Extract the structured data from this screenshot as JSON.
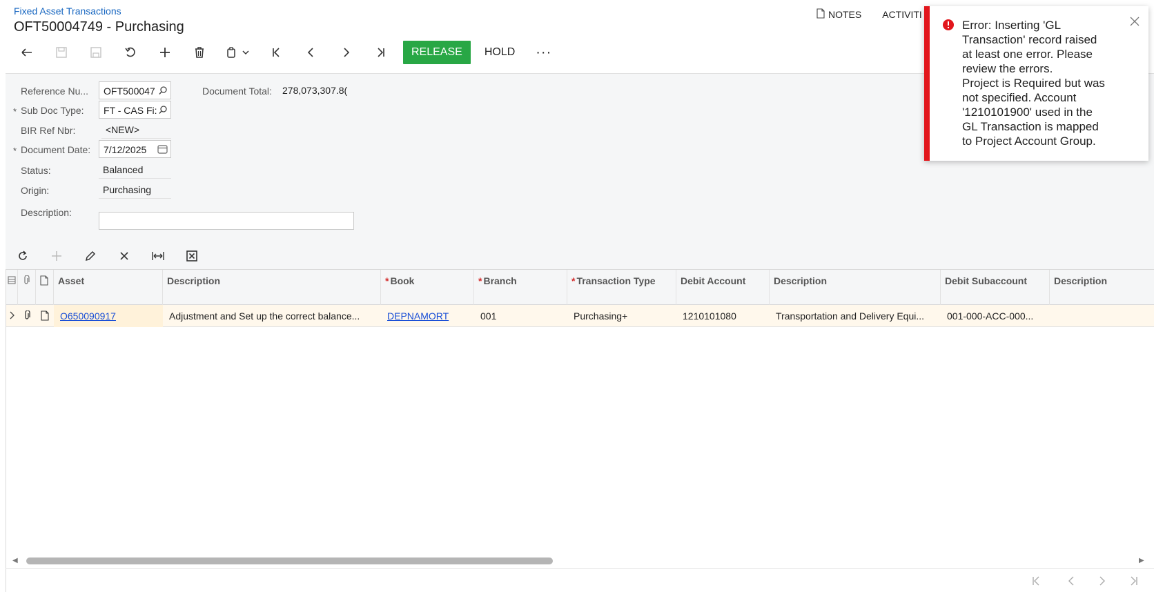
{
  "header": {
    "breadcrumb": "Fixed Asset Transactions",
    "title": "OFT50004749 - Purchasing",
    "notes_label": "NOTES",
    "activities_label": "ACTIVITI"
  },
  "toolbar": {
    "release_label": "RELEASE",
    "hold_label": "HOLD",
    "more_label": "···"
  },
  "form": {
    "ref_label": "Reference Nu...",
    "ref_value": "OFT500047",
    "subdoc_label": "Sub Doc Type:",
    "subdoc_value": "FT - CAS Fi:",
    "bir_label": "BIR Ref Nbr:",
    "bir_value": "<NEW>",
    "date_label": "Document Date:",
    "date_value": "7/12/2025",
    "status_label": "Status:",
    "status_value": "Balanced",
    "origin_label": "Origin:",
    "origin_value": "Purchasing",
    "description_label": "Description:",
    "description_value": "",
    "total_label": "Document Total:",
    "total_value": "278,073,307.8("
  },
  "grid": {
    "columns": {
      "asset": "Asset",
      "description": "Description",
      "book": "Book",
      "branch": "Branch",
      "transaction_type": "Transaction Type",
      "debit_account": "Debit Account",
      "debit_account_description": "Description",
      "debit_subaccount": "Debit Subaccount",
      "debit_subaccount_description": "Description"
    },
    "rows": [
      {
        "asset": "O650090917",
        "description": "Adjustment and Set up the correct balance...",
        "book": "DEPNAMORT",
        "branch": "001",
        "transaction_type": "Purchasing+",
        "debit_account": "1210101080",
        "debit_account_description": "Transportation and Delivery Equi...",
        "debit_subaccount": "001-000-ACC-000...",
        "debit_subaccount_description": ""
      }
    ]
  },
  "error_toast": {
    "lines": [
      "Error: Inserting  'GL",
      "Transaction' record raised",
      "at least one error. Please",
      "review the errors.",
      "Project is Required but was",
      "not specified. Account",
      "'1210101900' used in the",
      "GL Transaction is mapped",
      "to Project Account Group."
    ]
  },
  "colors": {
    "accent_link": "#1565c0",
    "release_bg": "#28a745",
    "error_red": "#e2161c",
    "selected_row": "#fff8ec"
  }
}
